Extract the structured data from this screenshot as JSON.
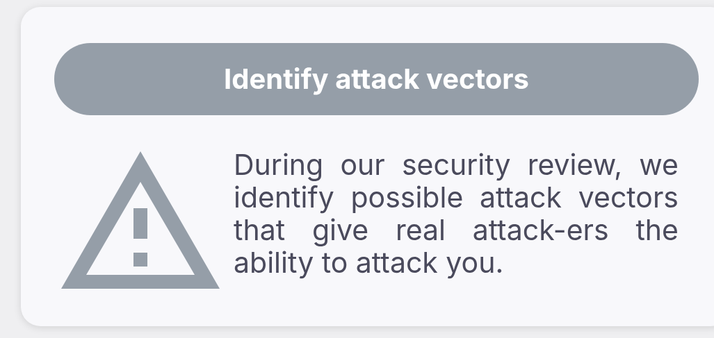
{
  "card": {
    "title": "Identify attack vectors",
    "text": "During our security review, we identify possible attack vectors that give real attack-ers the ability to attack you."
  }
}
